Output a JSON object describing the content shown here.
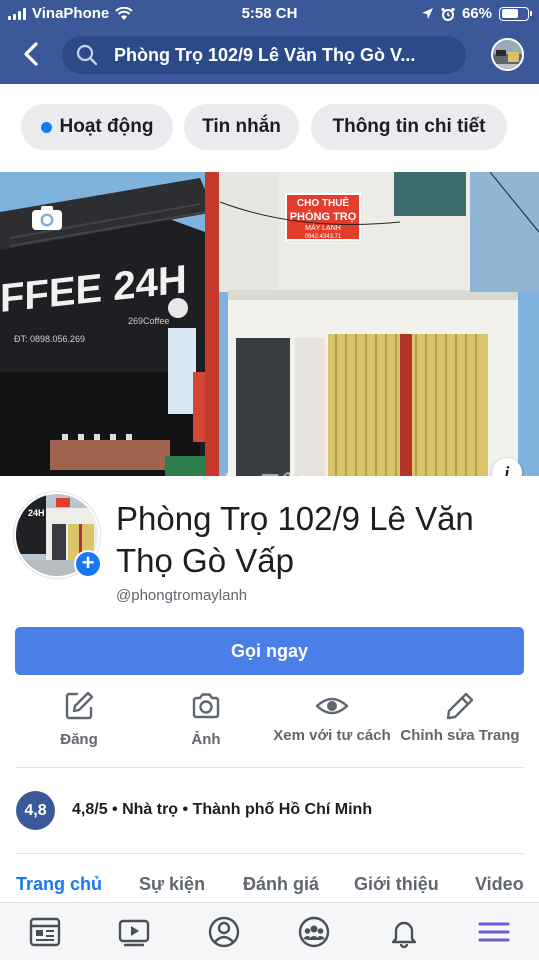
{
  "status_bar": {
    "carrier": "VinaPhone",
    "time": "5:58 CH",
    "battery_percent": "66%",
    "battery_level": 0.66
  },
  "header": {
    "back_icon": "chevron-left-icon",
    "search_text": "Phòng Trọ 102/9 Lê Văn Thọ Gò V...",
    "accent_color": "#3b5998"
  },
  "pills": [
    {
      "label": "Hoạt động",
      "active_dot": true
    },
    {
      "label": "Tin nhắn"
    },
    {
      "label": "Thông tin chi tiết"
    }
  ],
  "cover": {
    "cafe_sign": "FFEE 24H",
    "cafe_phone": "ĐT: 0898.056.269",
    "cafe_handle": "269Coffee",
    "rent_sign_line1": "CHO THUÊ",
    "rent_sign_line2": "PHÒNG TRỌ",
    "rent_sign_line3": "MÁY LẠNH",
    "rent_sign_phone": "0942.4343.71",
    "watermark": "chợTốt",
    "info_label": "i"
  },
  "profile": {
    "name": "Phòng Trọ 102/9 Lê Văn Thọ Gò Vấp",
    "handle": "@phongtromaylanh"
  },
  "call_button": "Gọi ngay",
  "actions": [
    {
      "label": "Đăng",
      "icon": "compose-icon"
    },
    {
      "label": "Ảnh",
      "icon": "camera-icon"
    },
    {
      "label": "Xem với tư cách",
      "icon": "eye-icon"
    },
    {
      "label": "Chỉnh sửa Trang",
      "icon": "pencil-icon"
    }
  ],
  "rating": {
    "badge": "4,8",
    "text": "4,8/5 • Nhà trọ • Thành phố Hồ Chí Minh"
  },
  "tabs": [
    {
      "label": "Trang chủ",
      "active": true
    },
    {
      "label": "Sự kiện"
    },
    {
      "label": "Đánh giá"
    },
    {
      "label": "Giới thiệu"
    },
    {
      "label": "Video"
    }
  ],
  "bottom_nav": [
    {
      "icon": "news-feed-icon"
    },
    {
      "icon": "watch-video-icon"
    },
    {
      "icon": "profile-icon"
    },
    {
      "icon": "groups-icon"
    },
    {
      "icon": "notifications-bell-icon"
    },
    {
      "icon": "menu-icon",
      "active": true
    }
  ]
}
